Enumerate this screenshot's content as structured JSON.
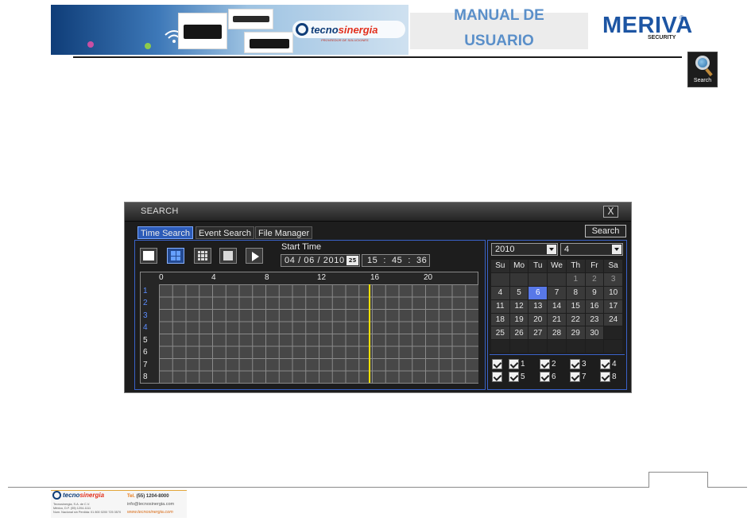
{
  "header": {
    "banner_logo_part1": "tecno",
    "banner_logo_part2": "sinergia",
    "banner_logo_tagline": "PROVEEDOR DE SOLUCIONES",
    "manual_line1": "MANUAL DE",
    "manual_line2": "USUARIO",
    "brand": "MERIVA",
    "brand_registered": "®",
    "brand_sub": "SECURITY",
    "search_icon_label": "Search"
  },
  "dialog": {
    "title": "SEARCH",
    "close": "X",
    "tabs": [
      {
        "label": "Time Search",
        "active": true
      },
      {
        "label": "Event Search",
        "active": false
      },
      {
        "label": "File Manager",
        "active": false
      }
    ],
    "search_button": "Search",
    "start_time_label": "Start Time",
    "date_value": "04 / 06 / 2010",
    "calendar_icon_text": "25",
    "time_value": "15  :  45  :  36",
    "hours": [
      "0",
      "4",
      "8",
      "12",
      "16",
      "20"
    ],
    "channels": [
      "1",
      "2",
      "3",
      "4",
      "5",
      "6",
      "7",
      "8"
    ],
    "year": "2010",
    "month": "4",
    "weekdays": [
      "Su",
      "Mo",
      "Tu",
      "We",
      "Th",
      "Fr",
      "Sa"
    ],
    "calendar_days": [
      [
        "",
        "",
        "",
        "",
        "1",
        "2",
        "3"
      ],
      [
        "4",
        "5",
        "6",
        "7",
        "8",
        "9",
        "10"
      ],
      [
        "11",
        "12",
        "13",
        "14",
        "15",
        "16",
        "17"
      ],
      [
        "18",
        "19",
        "20",
        "21",
        "22",
        "23",
        "24"
      ],
      [
        "25",
        "26",
        "27",
        "28",
        "29",
        "30",
        ""
      ],
      [
        "",
        "",
        "",
        "",
        "",
        "",
        ""
      ]
    ],
    "selected_day": "6",
    "checkbox_rows": [
      [
        "1",
        "2",
        "3",
        "4"
      ],
      [
        "5",
        "6",
        "7",
        "8"
      ]
    ],
    "cursor_hour": 15.75
  },
  "footer": {
    "logo_part1": "tecno",
    "logo_part2": "sinergia",
    "company": "Tecnosinergia, S.A. de C.V.",
    "address": "México, D.F. (55) 1204-1111",
    "toll": "Num. Nacional sin Perdida: 01 800 0200 725 3570",
    "tel_label": "Tel.",
    "tel": "(55) 1204-8000",
    "email": "info@tecnosinergia.com",
    "web": "www.tecnosinergia.com"
  },
  "colors": {
    "accent_blue": "#3a62c8",
    "tab_active": "#2c5bb8",
    "selected_day": "#5878e8",
    "cursor": "#f0e000",
    "brand_blue": "#1d55a3"
  }
}
